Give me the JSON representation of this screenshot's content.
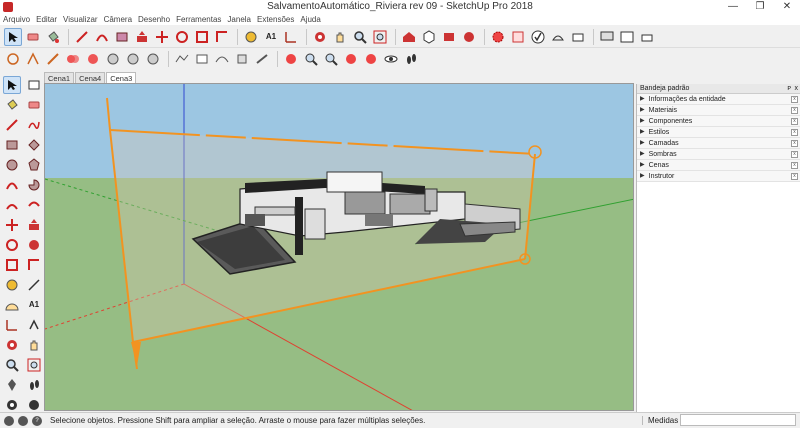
{
  "window": {
    "title": "SalvamentoAutomático_Riviera rev 09 - SketchUp Pro 2018",
    "minimize": "—",
    "maximize": "❐",
    "close": "✕"
  },
  "menu": [
    "Arquivo",
    "Editar",
    "Visualizar",
    "Câmera",
    "Desenho",
    "Ferramentas",
    "Janela",
    "Extensões",
    "Ajuda"
  ],
  "tabs": [
    {
      "label": "Cena1",
      "active": false
    },
    {
      "label": "Cena4",
      "active": false
    },
    {
      "label": "Cena3",
      "active": true
    }
  ],
  "tray": {
    "title": "Bandeja padrão",
    "pin": "ᴘ",
    "close": "x",
    "panels": [
      "Informações da entidade",
      "Materiais",
      "Componentes",
      "Estilos",
      "Camadas",
      "Sombras",
      "Cenas",
      "Instrutor"
    ]
  },
  "status": {
    "text": "Selecione objetos. Pressione Shift para ampliar a seleção. Arraste o mouse para fazer múltiplas seleções.",
    "measurements_label": "Medidas",
    "measurements_value": ""
  },
  "colors": {
    "sky": "#9cc6e2",
    "ground": "#96bd84",
    "section_plane": "#f29321",
    "axis_red": "#e04030",
    "axis_green": "#30a030",
    "axis_blue": "#3048d0"
  },
  "toolbar_icons_row1": [
    "select-icon",
    "eraser-icon",
    "paint-bucket-icon",
    "line-icon",
    "arc-icon",
    "shape-icon",
    "push-pull-icon",
    "move-icon",
    "rotate-icon",
    "scale-icon",
    "offset-icon",
    "tape-measure-icon",
    "text-icon",
    "axes-icon",
    "dimension-icon",
    "protractor-icon",
    "orbit-icon",
    "pan-icon",
    "zoom-icon",
    "zoom-window-icon",
    "zoom-extents-icon",
    "previous-view-icon",
    "section-plane-icon",
    "warehouse-icon",
    "component-icon",
    "extension-icon",
    "model-info-icon",
    "solid-tools-icon",
    "sandbox-icon",
    "styles-icon",
    "camera-icon",
    "xray-icon",
    "print-icon"
  ],
  "toolbar_icons_row2": [
    "circle-icon",
    "follow-me-icon",
    "intersect-icon",
    "outer-shell-icon",
    "union-icon",
    "subtract-icon",
    "trim-icon",
    "split-icon",
    "from-contours-icon",
    "from-scratch-icon",
    "smoove-icon",
    "stamp-icon",
    "drape-icon",
    "add-detail-icon",
    "flip-edge-icon",
    "position-camera-icon",
    "look-around-icon",
    "walk-icon",
    "section-fill-icon",
    "display-section-icon",
    "footprints-icon"
  ],
  "left_tools": [
    "select-icon",
    "component-icon",
    "paint-bucket-icon",
    "eraser-icon",
    "line-icon",
    "freehand-icon",
    "rectangle-icon",
    "rotated-rectangle-icon",
    "circle-icon",
    "polygon-icon",
    "arc-icon",
    "pie-icon",
    "two-point-arc-icon",
    "three-point-arc-icon",
    "move-icon",
    "push-pull-icon",
    "rotate-icon",
    "follow-me-icon",
    "scale-icon",
    "offset-icon",
    "tape-measure-icon",
    "dimension-icon",
    "protractor-icon",
    "text-icon",
    "axes-icon",
    "3d-text-icon",
    "orbit-icon",
    "pan-icon",
    "zoom-icon",
    "zoom-extents-icon",
    "position-camera-icon",
    "walk-icon",
    "look-around-icon",
    "section-plane-icon"
  ]
}
